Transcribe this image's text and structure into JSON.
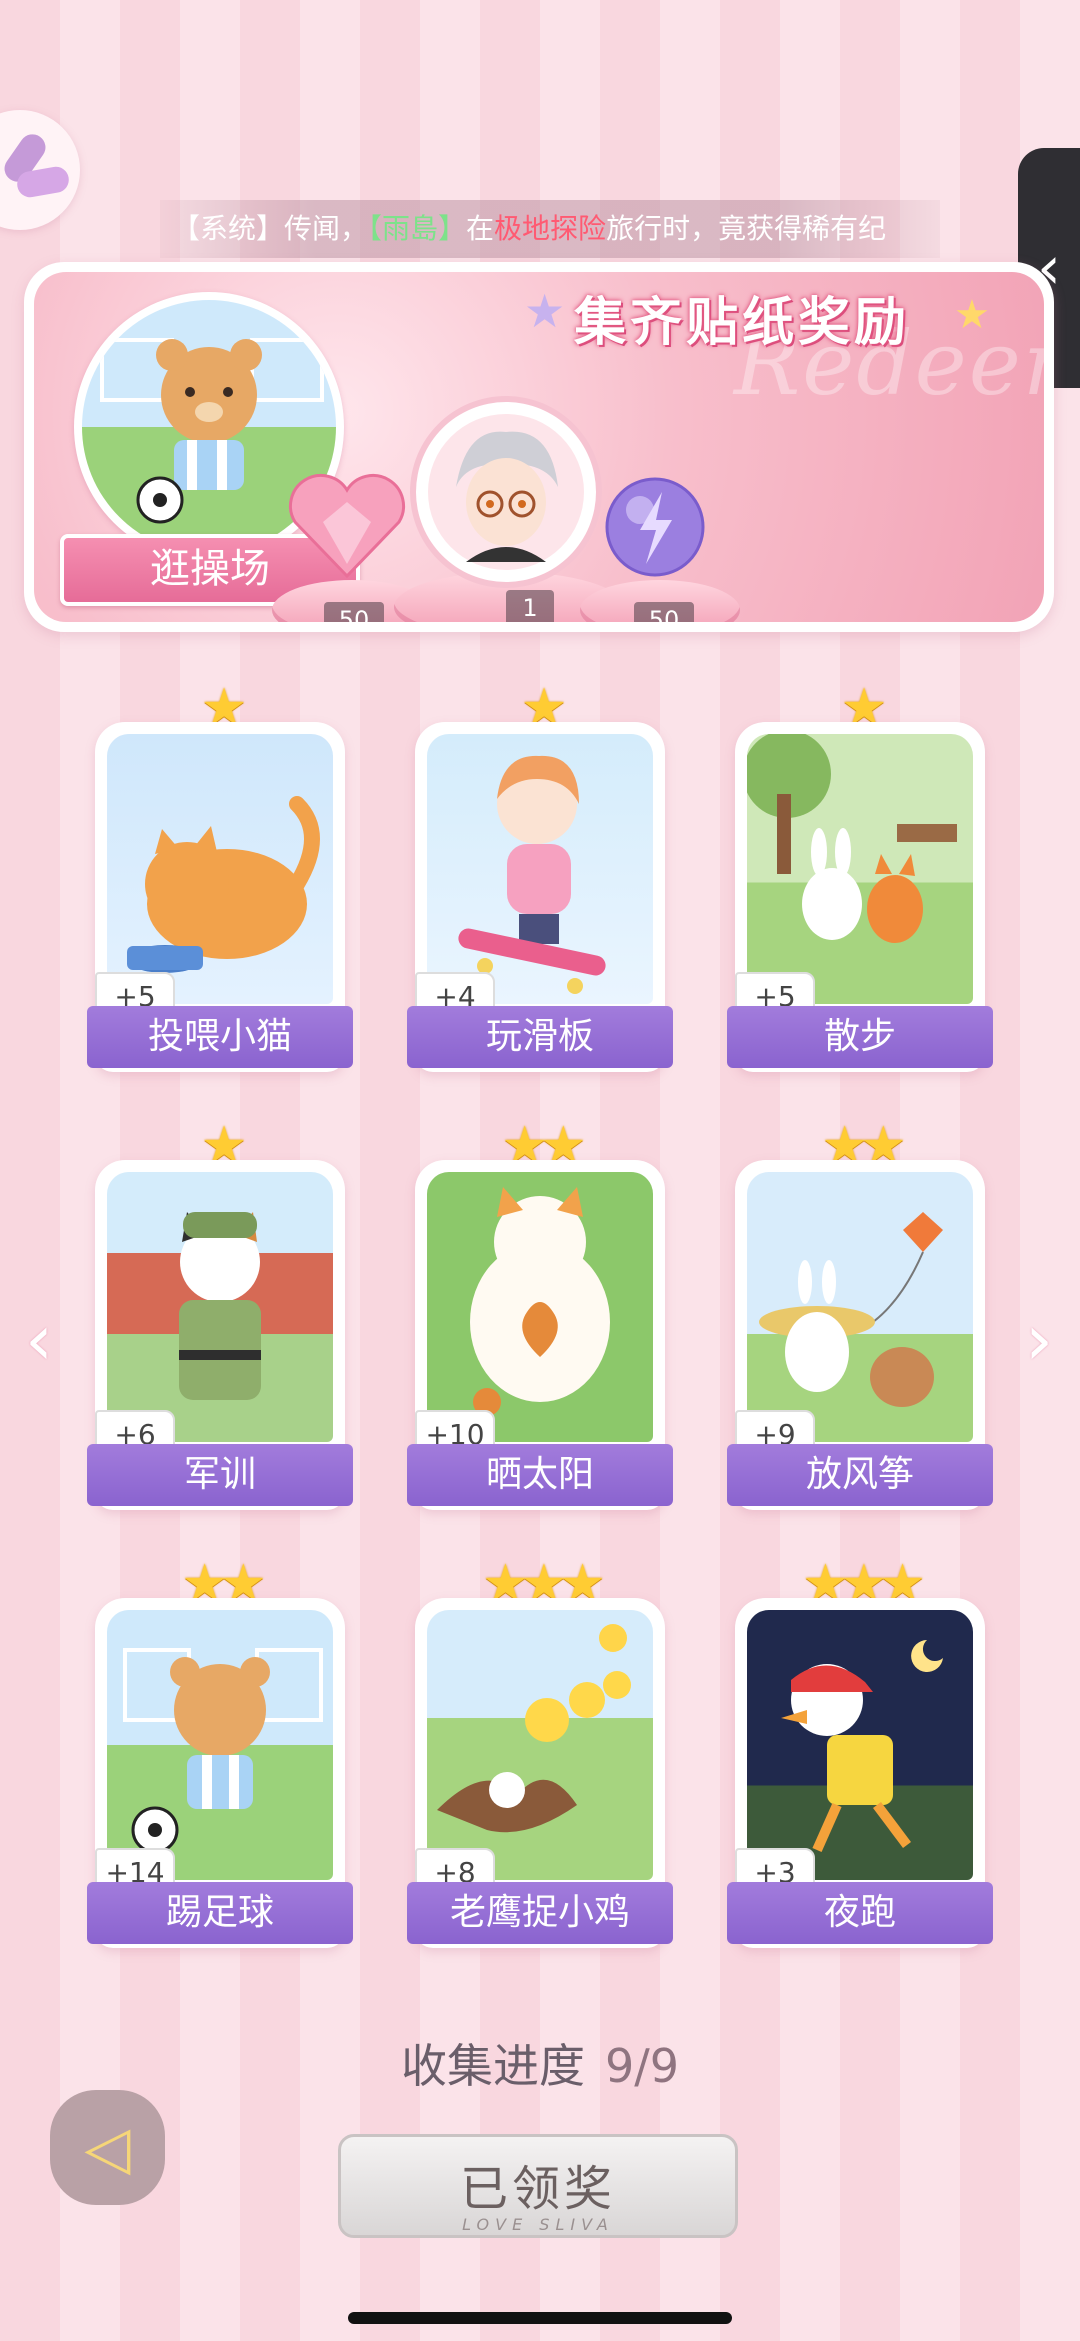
{
  "notice": {
    "prefix": "【系统】传闻，",
    "player": "【雨島】",
    "middle": "在",
    "place": "极地探险",
    "suffix": "旅行时，竟获得稀有纪"
  },
  "banner": {
    "title": "集齐贴纸奖励",
    "watermark": "Redeem",
    "cover_label": "逛操场",
    "rewards": [
      {
        "icon": "pink-heart-gem-icon",
        "count": "50"
      },
      {
        "icon": "character-avatar-icon",
        "count": "1"
      },
      {
        "icon": "purple-energy-orb-icon",
        "count": "50"
      }
    ]
  },
  "cards": [
    {
      "name": "投喂小猫",
      "points": "+5",
      "stars": "★"
    },
    {
      "name": "玩滑板",
      "points": "+4",
      "stars": "★"
    },
    {
      "name": "散步",
      "points": "+5",
      "stars": "★"
    },
    {
      "name": "军训",
      "points": "+6",
      "stars": "★"
    },
    {
      "name": "晒太阳",
      "points": "+10",
      "stars": "★★"
    },
    {
      "name": "放风筝",
      "points": "+9",
      "stars": "★★"
    },
    {
      "name": "踢足球",
      "points": "+14",
      "stars": "★★"
    },
    {
      "name": "老鹰捉小鸡",
      "points": "+8",
      "stars": "★★★"
    },
    {
      "name": "夜跑",
      "points": "+3",
      "stars": "★★★"
    }
  ],
  "progress": {
    "label": "收集进度",
    "value": "9/9"
  },
  "claim_button": {
    "label": "已领奖",
    "subtitle": "LOVE SLIVA"
  },
  "colors": {
    "accent_purple": "#8a63cf",
    "banner_pink": "#f2a3b6",
    "star_gold": "#ffcc33"
  }
}
